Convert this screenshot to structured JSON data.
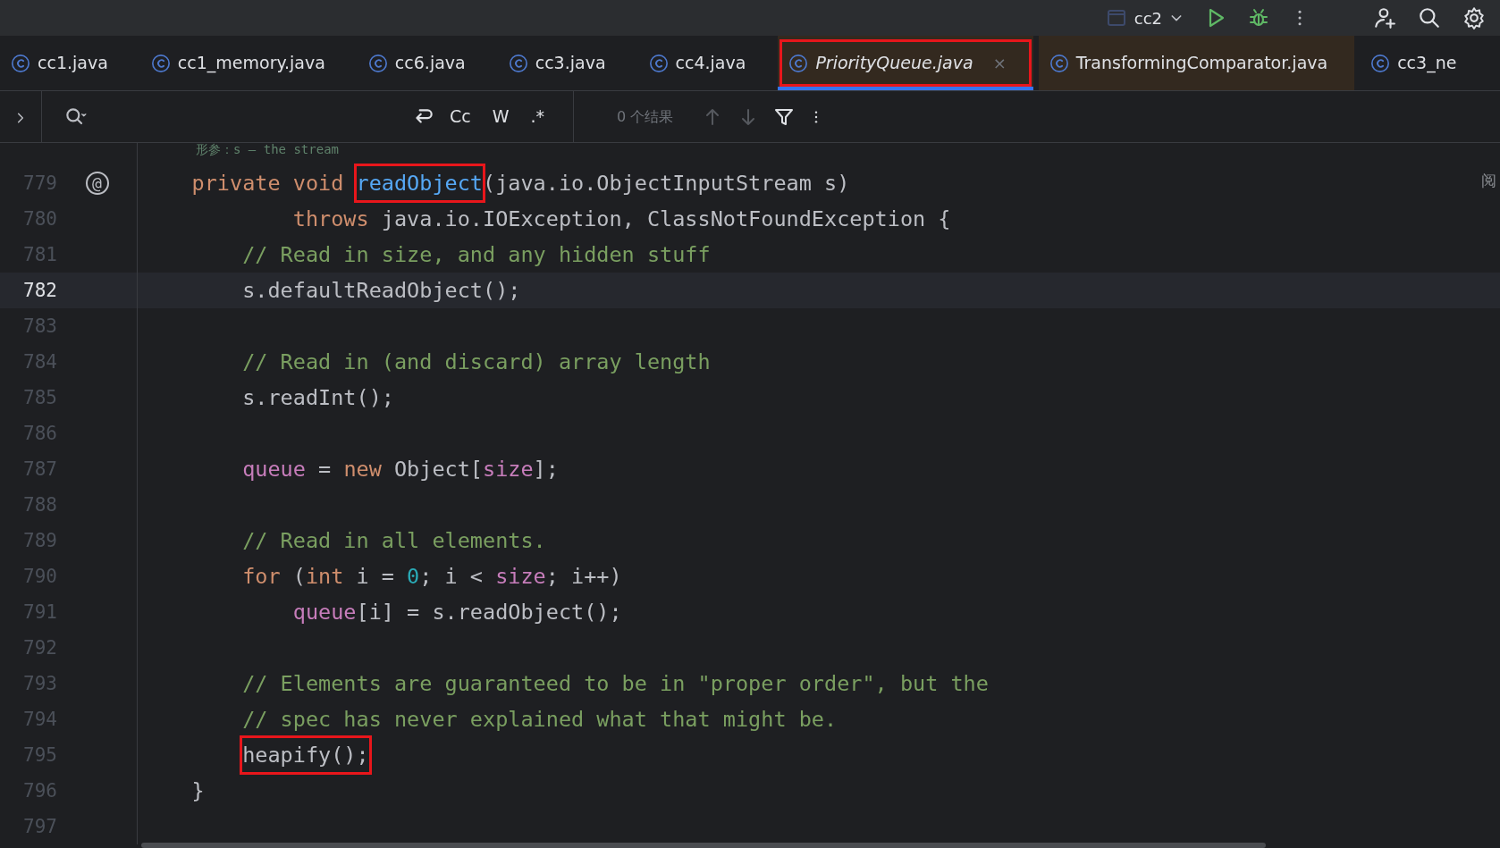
{
  "toolbar": {
    "project": "cc2"
  },
  "tabs": [
    {
      "label": "cc1.java",
      "selected": false,
      "preview": false,
      "tinted": false,
      "boxed": false
    },
    {
      "label": "cc1_memory.java",
      "selected": false,
      "preview": false,
      "tinted": false,
      "boxed": false
    },
    {
      "label": "cc6.java",
      "selected": false,
      "preview": false,
      "tinted": false,
      "boxed": false
    },
    {
      "label": "cc3.java",
      "selected": false,
      "preview": false,
      "tinted": false,
      "boxed": false
    },
    {
      "label": "cc4.java",
      "selected": false,
      "preview": false,
      "tinted": false,
      "boxed": false
    },
    {
      "label": "PriorityQueue.java",
      "selected": true,
      "preview": true,
      "tinted": true,
      "boxed": true,
      "close": "×"
    },
    {
      "label": "TransformingComparator.java",
      "selected": false,
      "preview": false,
      "tinted": true,
      "boxed": false
    },
    {
      "label": "cc3_ne",
      "selected": false,
      "preview": false,
      "tinted": false,
      "boxed": false
    }
  ],
  "search": {
    "options": [
      "Cc",
      "W",
      ".*"
    ],
    "result": "0 个结果"
  },
  "editor": {
    "doc_line": "形参：s – the stream",
    "side_label": "阅",
    "lines": [
      {
        "number": "779",
        "current": false,
        "gutter_mark": "@",
        "tokens": [
          {
            "kind": "keyword",
            "text": "private void "
          },
          {
            "kind": "method",
            "text": "readObject",
            "boxed": true
          },
          {
            "kind": "plain",
            "text": "(java.io.ObjectInputStream s)"
          }
        ],
        "children": [
          {
            "number": "780",
            "current": false,
            "kind": "continuation",
            "tokens": [
              {
                "kind": "keyword",
                "text": "throws "
              },
              {
                "kind": "plain",
                "text": "java.io.IOException, ClassNotFoundException {"
              }
            ]
          },
          {
            "number": "781",
            "current": false,
            "tokens": [
              {
                "kind": "comment",
                "text": "// Read in size, and any hidden stuff"
              }
            ]
          },
          {
            "number": "782",
            "current": true,
            "tokens": [
              {
                "kind": "plain",
                "text": "s.defaultReadObject();"
              }
            ]
          },
          {
            "number": "783",
            "current": false
          },
          {
            "number": "784",
            "current": false,
            "tokens": [
              {
                "kind": "comment",
                "text": "// Read in (and discard) array length"
              }
            ]
          },
          {
            "number": "785",
            "current": false,
            "tokens": [
              {
                "kind": "plain",
                "text": "s.readInt();"
              }
            ]
          },
          {
            "number": "786",
            "current": false
          },
          {
            "number": "787",
            "current": false,
            "tokens": [
              {
                "kind": "field",
                "text": "queue"
              },
              {
                "kind": "plain",
                "text": " = "
              },
              {
                "kind": "keyword",
                "text": "new "
              },
              {
                "kind": "plain",
                "text": "Object["
              },
              {
                "kind": "field",
                "text": "size"
              },
              {
                "kind": "plain",
                "text": "];"
              }
            ]
          },
          {
            "number": "788",
            "current": false
          },
          {
            "number": "789",
            "current": false,
            "tokens": [
              {
                "kind": "comment",
                "text": "// Read in all elements."
              }
            ]
          },
          {
            "number": "790",
            "current": false,
            "tokens": [
              {
                "kind": "keyword",
                "text": "for "
              },
              {
                "kind": "plain",
                "text": "("
              },
              {
                "kind": "keyword",
                "text": "int "
              },
              {
                "kind": "plain",
                "text": "i = "
              },
              {
                "kind": "number",
                "text": "0"
              },
              {
                "kind": "plain",
                "text": "; i < "
              },
              {
                "kind": "field",
                "text": "size"
              },
              {
                "kind": "plain",
                "text": "; i++)"
              }
            ],
            "children": [
              {
                "number": "791",
                "current": false,
                "tokens": [
                  {
                    "kind": "field",
                    "text": "queue"
                  },
                  {
                    "kind": "plain",
                    "text": "[i] = s.readObject();"
                  }
                ]
              }
            ]
          },
          {
            "number": "792",
            "current": false
          },
          {
            "number": "793",
            "current": false,
            "tokens": [
              {
                "kind": "comment",
                "text": "// Elements are guaranteed to be in \"proper order\", but the"
              }
            ]
          },
          {
            "number": "794",
            "current": false,
            "tokens": [
              {
                "kind": "comment",
                "text": "// spec has never explained what that might be."
              }
            ]
          },
          {
            "number": "795",
            "current": false,
            "tokens": [
              {
                "kind": "plain",
                "text": "heapify();",
                "boxed": true
              }
            ]
          }
        ]
      },
      {
        "number": "796",
        "current": false,
        "tokens": [
          {
            "kind": "plain",
            "text": "}"
          }
        ]
      },
      {
        "number": "797",
        "current": false
      }
    ]
  }
}
